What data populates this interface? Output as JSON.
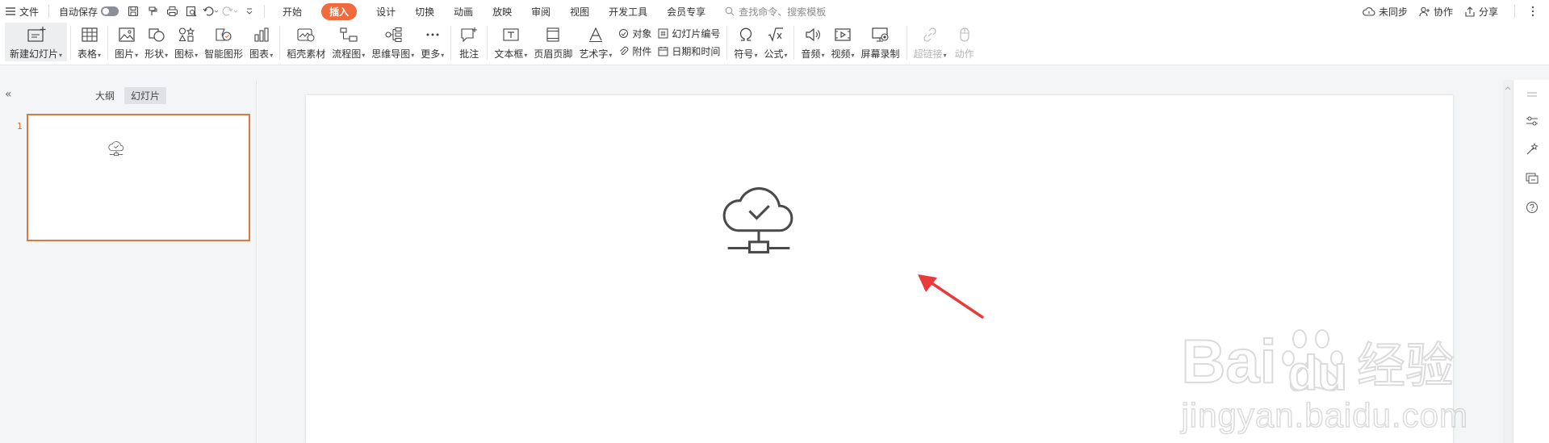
{
  "menubar": {
    "menu_label": "文件",
    "autosave_label": "自动保存",
    "tabs": [
      "开始",
      "插入",
      "设计",
      "切换",
      "动画",
      "放映",
      "审阅",
      "视图",
      "开发工具",
      "会员专享"
    ],
    "active_tab": "插入",
    "search_placeholder": "查找命令、搜索模板",
    "unsync_label": "未同步",
    "collab_label": "协作",
    "share_label": "分享"
  },
  "ribbon": {
    "new_slide": "新建幻灯片",
    "table": "表格",
    "picture": "图片",
    "shape": "形状",
    "icon": "图标",
    "smart_shape": "智能图形",
    "chart": "图表",
    "material": "稻壳素材",
    "flowchart": "流程图",
    "mindmap": "思维导图",
    "more": "更多",
    "comment": "批注",
    "textbox": "文本框",
    "header_footer": "页眉页脚",
    "wordart": "艺术字",
    "object": "对象",
    "attachment": "附件",
    "slide_number": "幻灯片编号",
    "date_time": "日期和时间",
    "symbol": "符号",
    "formula": "公式",
    "audio": "音频",
    "video": "视频",
    "screen_record": "屏幕录制",
    "hyperlink": "超链接",
    "action": "动作"
  },
  "panel": {
    "collapse": "«",
    "outline_tab": "大纲",
    "slides_tab": "幻灯片",
    "slide_number": "1"
  },
  "watermark": {
    "brand": "Bai",
    "brand2": "du",
    "brand_cn": "经验",
    "url": "jingyan.baidu.com"
  },
  "colors": {
    "accent": "#f06a3c",
    "thumb_border": "#d97a43",
    "arrow": "#e83a3a"
  }
}
